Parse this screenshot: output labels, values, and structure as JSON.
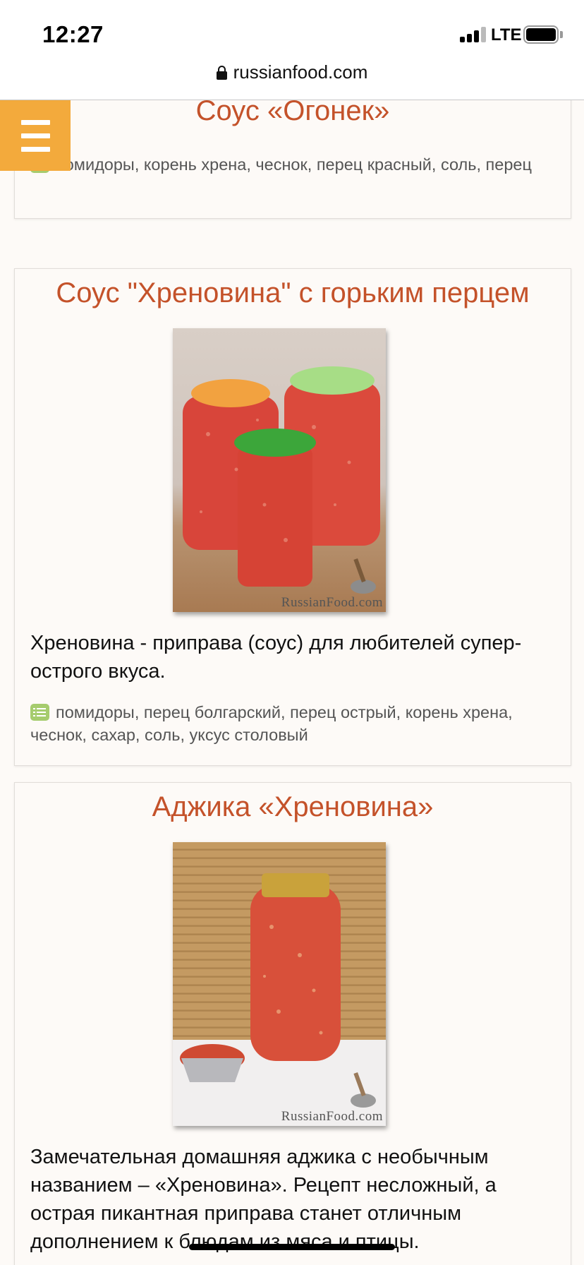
{
  "status_bar": {
    "time": "12:27",
    "network": "LTE"
  },
  "browser": {
    "url": "russianfood.com"
  },
  "menu": {
    "icon": "hamburger-menu-icon"
  },
  "recipes": [
    {
      "title": "Соус «Огонек»",
      "ingredients": "помидоры, корень хрена, чеснок, перец красный, соль, перец"
    },
    {
      "title": "Соус \"Хреновина\" с горьким перцем",
      "watermark": "RussianFood.com",
      "description": "Хреновина - приправа (соус) для любителей супер-острого вкуса.",
      "ingredients": "помидоры, перец болгарский, перец острый, корень хрена, чеснок, сахар, соль, уксус столовый"
    },
    {
      "title": "Аджика «Хреновина»",
      "watermark": "RussianFood.com",
      "description": "Замечательная домашняя аджика с необычным названием – «Хреновина». Рецепт несложный, а острая пикантная приправа станет отличным дополнением к блюдам из мяса и птицы."
    }
  ],
  "colors": {
    "accent": "#f3aa3c",
    "title": "#c4522a",
    "page_bg": "#fdfaf7",
    "icon_green": "#a6cc6e"
  }
}
